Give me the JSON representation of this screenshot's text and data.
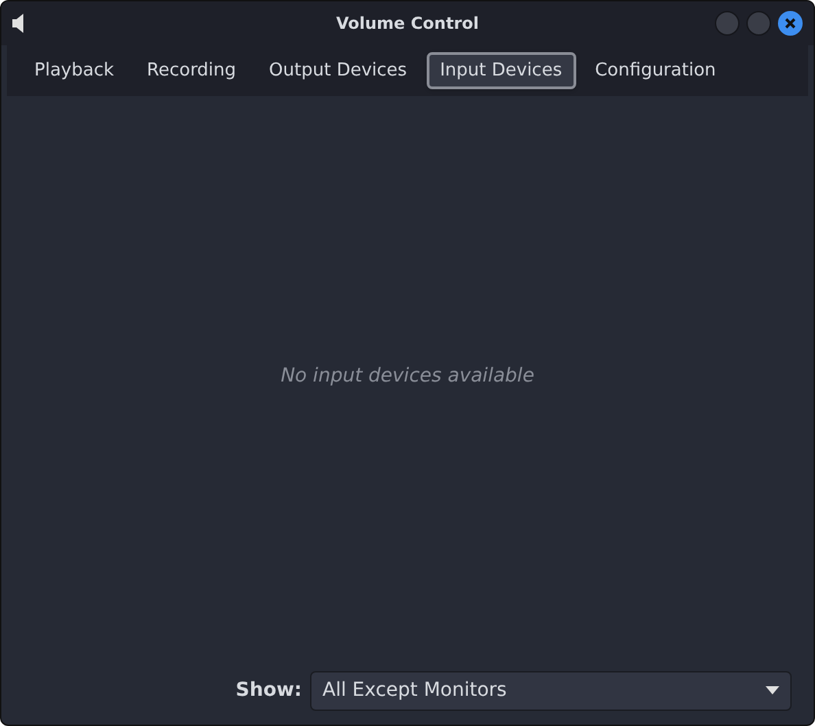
{
  "window": {
    "title": "Volume Control"
  },
  "tabs": [
    {
      "label": "Playback",
      "selected": false
    },
    {
      "label": "Recording",
      "selected": false
    },
    {
      "label": "Output Devices",
      "selected": false
    },
    {
      "label": "Input Devices",
      "selected": true
    },
    {
      "label": "Configuration",
      "selected": false
    }
  ],
  "empty_message": "No input devices available",
  "show": {
    "label": "Show:",
    "value": "All Except Monitors"
  }
}
